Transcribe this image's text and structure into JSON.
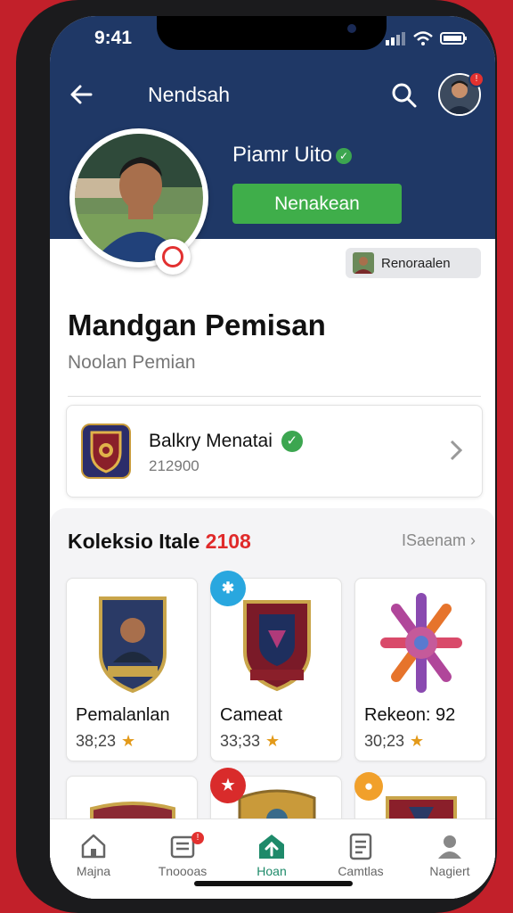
{
  "status_bar": {
    "time": "9:41"
  },
  "header": {
    "title": "Nendsah"
  },
  "profile": {
    "name": "Piamr Uito",
    "follow_label": "Nenakean",
    "recommend_label": "Renoraalen"
  },
  "main": {
    "heading": "Mandgan Pemisan",
    "subheading": "Noolan Pemian"
  },
  "club_card": {
    "name": "Balkry Menatai",
    "number": "212900"
  },
  "collection": {
    "title": "Koleksio Itale",
    "year": "2108",
    "see_all": "ISaenam",
    "items": [
      {
        "label": "Pemalanlan",
        "price": "38;23"
      },
      {
        "label": "Cameat",
        "price": "33;33"
      },
      {
        "label": "Rekeon: 92",
        "price": "30;23"
      }
    ]
  },
  "tabs": [
    {
      "label": "Majna",
      "icon": "home-icon"
    },
    {
      "label": "Tnoooas",
      "icon": "inbox-icon"
    },
    {
      "label": "Hoan",
      "icon": "upload-icon"
    },
    {
      "label": "Camtlas",
      "icon": "list-icon"
    },
    {
      "label": "Nagiert",
      "icon": "profile-icon"
    }
  ],
  "colors": {
    "header": "#1f3866",
    "accent_green": "#3fae4a",
    "badge_red": "#e2312f"
  }
}
